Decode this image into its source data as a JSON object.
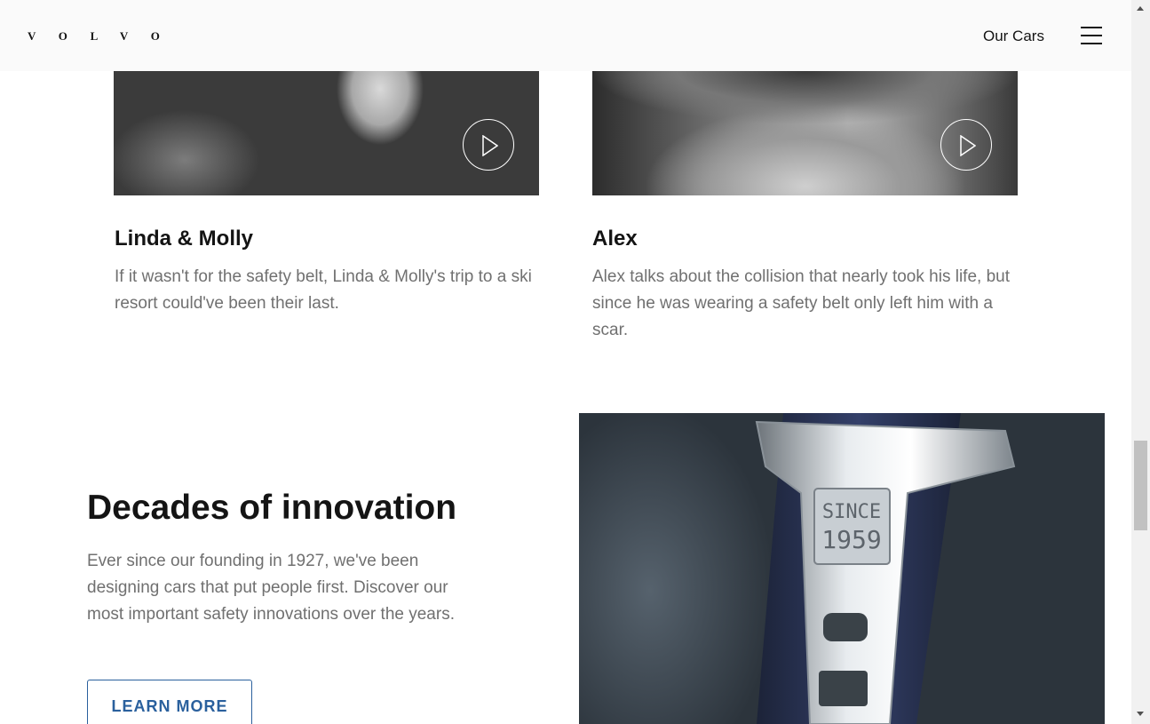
{
  "header": {
    "logo": "V O L V O",
    "nav_link": "Our Cars",
    "menu_icon": "hamburger-menu-icon"
  },
  "stories": [
    {
      "title": "Linda & Molly",
      "text": "If it wasn't for the safety belt, Linda & Molly's trip to a ski resort could've been their last.",
      "play_icon": "play-icon"
    },
    {
      "title": "Alex",
      "text": "Alex talks about the collision that nearly took his life, but since he was wearing a safety belt only left him with a scar.",
      "play_icon": "play-icon"
    }
  ],
  "innovation": {
    "title": "Decades of innovation",
    "text": "Ever since our founding in 1927, we've been designing cars that put people first. Discover our most important safety innovations over the years.",
    "button_label": "LEARN MORE",
    "image_caption": [
      "SINCE",
      "1959"
    ]
  },
  "colors": {
    "header_bg": "#fafafa",
    "text_primary": "#141414",
    "text_secondary": "#707070",
    "accent": "#2a609d"
  }
}
